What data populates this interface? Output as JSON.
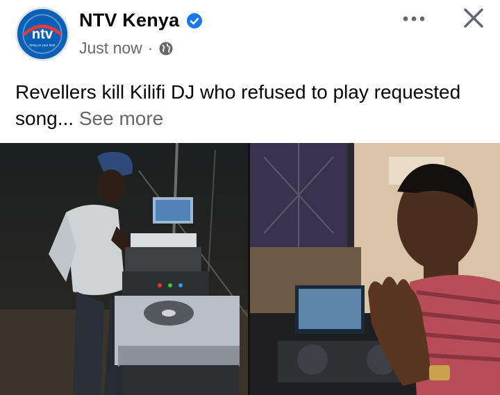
{
  "post": {
    "page_name": "NTV Kenya",
    "verified": true,
    "timestamp": "Just now",
    "separator": "·",
    "audience_icon": "globe-icon",
    "caption": "Revellers kill Kilifi DJ who refused to play requested song...",
    "see_more_label": "See more",
    "logo_text": "ntv",
    "logo_tagline": "bring on your best",
    "photos": [
      {
        "description_icon": "dj-at-turntables-photo"
      },
      {
        "description_icon": "dj-selfie-photo"
      }
    ]
  },
  "colors": {
    "brand": "#0b5fb5",
    "verified_badge": "#1877f2",
    "text_primary": "#050505",
    "text_secondary": "#65676b"
  }
}
